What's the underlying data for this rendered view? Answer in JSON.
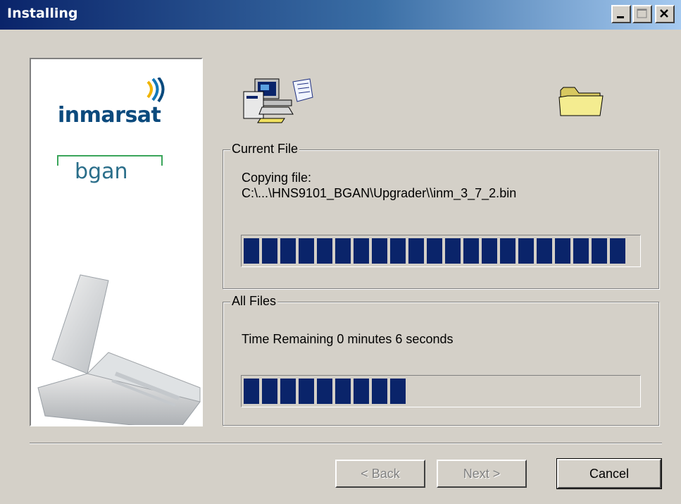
{
  "window": {
    "title": "Installing",
    "controls": {
      "minimize": "minimize",
      "maximize": "maximize",
      "close": "close"
    }
  },
  "branding": {
    "logo_text": "inmarsat",
    "sub_logo_text": "bgan"
  },
  "current_file": {
    "group_label": "Current File",
    "status_line1": "Copying file:",
    "status_line2": "C:\\...\\HNS9101_BGAN\\Upgrader\\\\inm_3_7_2.bin",
    "progress": 1.0
  },
  "all_files": {
    "group_label": "All Files",
    "status": "Time Remaining 0 minutes 6 seconds",
    "progress": 0.45
  },
  "buttons": {
    "back_label": "< Back",
    "next_label": "Next >",
    "cancel_label": "Cancel"
  },
  "colors": {
    "titlebar_start": "#0a246a",
    "titlebar_end": "#a6caf0",
    "progress_fill": "#0a246a",
    "dialog_bg": "#d4d0c8"
  },
  "icons": [
    "computer-install-icon",
    "folder-icon",
    "satellite-terminal-image",
    "signal-waves-icon"
  ]
}
